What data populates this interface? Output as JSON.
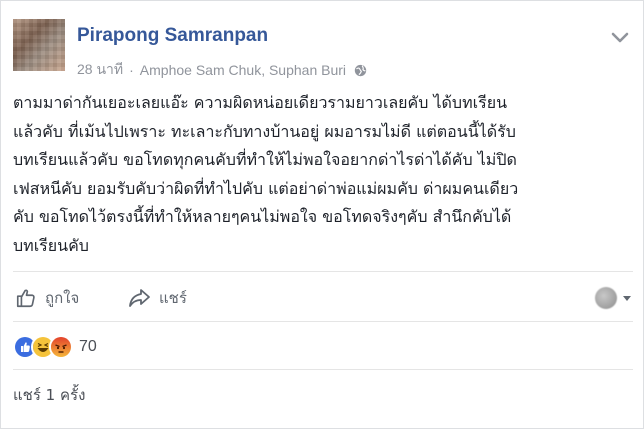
{
  "post": {
    "author": "Pirapong Samranpan",
    "time": "28 นาที",
    "separator": "·",
    "location": "Amphoe Sam Chuk, Suphan Buri",
    "privacy_icon": "globe-icon",
    "menu_icon": "chevron-down-icon",
    "text_lines": [
      "ตามมาด่ากันเยอะเลยแอ๊ะ ความผิดหน่อยเดียวรามยาวเลยคับ ได้บทเรียน",
      "แล้วคับ ที่เม้นไปเพราะ ทะเลาะกับทางบ้านอยู่ ผมอารมไม่ดี แต่ตอนนี้ได้รับ",
      "บทเรียนแล้วคับ ขอโทดทุกคนคับที่ทำให้ไม่พอใจอยากด่าไรด่าได้คับ ไม่ปิด",
      "เฟสหนีคับ ยอมรับคับว่าผิดที่ทำไปคับ แต่อย่าด่าพ่อแม่ผมคับ ด่าผมคนเดียว",
      "คับ ขอโทดไว้ตรงนี้ที่ทำให้หลายๆคนไม่พอใจ ขอโทดจริงๆคับ สำนึกคับได้",
      "บทเรียนคับ"
    ]
  },
  "actions": {
    "like_label": "ถูกใจ",
    "share_label": "แชร์",
    "like_icon": "thumbs-up-icon",
    "share_icon": "share-arrow-icon"
  },
  "reactions": {
    "count": "70",
    "types": [
      "like",
      "haha",
      "angry"
    ],
    "colors": {
      "like": "#3b6de0",
      "haha": "#f5c33b",
      "angry": "#e9710f"
    }
  },
  "shares": {
    "text": "แชร์ 1 ครั้ง"
  },
  "colors": {
    "author": "#365899",
    "meta": "#90949c",
    "text": "#1d2129"
  }
}
